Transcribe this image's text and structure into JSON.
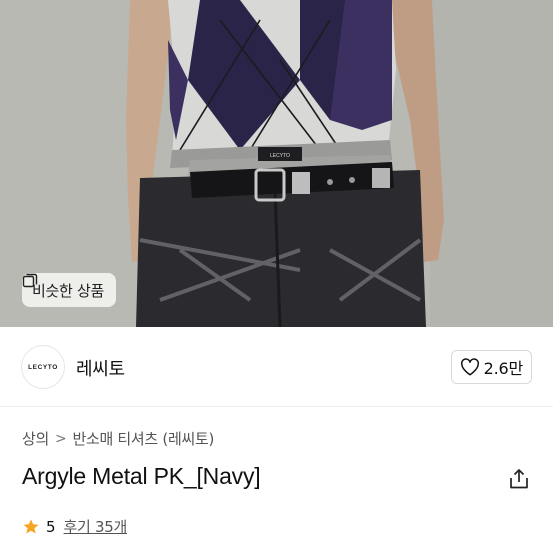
{
  "hero": {
    "image_description_icon": "product-photo",
    "similar_button_label": "비슷한 상품",
    "similar_button_icon": "copy-icon",
    "waistband_tag": "LECYTO"
  },
  "shop": {
    "logo_text": "LECYTO",
    "name": "레씨토",
    "like_count": "2.6만",
    "like_icon": "heart-outline-icon"
  },
  "breadcrumb": {
    "items": [
      "상의",
      "반소매 티셔츠 (레씨토)"
    ],
    "separator": ">"
  },
  "product": {
    "title": "Argyle Metal PK_[Navy]",
    "share_icon": "share-icon"
  },
  "rating": {
    "star_icon": "star-icon",
    "star_color": "#f5a623",
    "score": "5",
    "reviews_label": "후기 35개"
  }
}
